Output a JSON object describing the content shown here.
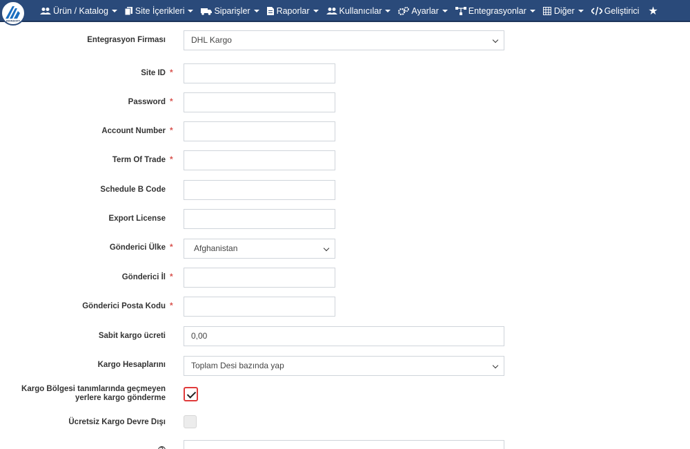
{
  "nav": {
    "items": [
      {
        "label": "Ürün / Katalog",
        "icon": "users-icon"
      },
      {
        "label": "Site İçerikleri",
        "icon": "copy-icon"
      },
      {
        "label": "Siparişler",
        "icon": "truck-icon"
      },
      {
        "label": "Raporlar",
        "icon": "file-icon"
      },
      {
        "label": "Kullanıcılar",
        "icon": "users-icon"
      },
      {
        "label": "Ayarlar",
        "icon": "gears-icon"
      },
      {
        "label": "Entegrasyonlar",
        "icon": "network-icon"
      },
      {
        "label": "Diğer",
        "icon": "grid-icon"
      },
      {
        "label": "Geliştirici",
        "icon": "code-icon"
      }
    ],
    "logo_text": "AKINSOFT"
  },
  "form": {
    "firm": {
      "label": "Entegrasyon Firması",
      "value": "DHL Kargo"
    },
    "site_id": {
      "label": "Site ID",
      "value": ""
    },
    "password": {
      "label": "Password",
      "value": ""
    },
    "account_number": {
      "label": "Account Number",
      "value": ""
    },
    "term_of_trade": {
      "label": "Term Of Trade",
      "value": ""
    },
    "schedule_b": {
      "label": "Schedule B Code",
      "value": ""
    },
    "export_license": {
      "label": "Export License",
      "value": ""
    },
    "sender_country": {
      "label": "Gönderici Ülke",
      "value": "Afghanistan"
    },
    "sender_city": {
      "label": "Gönderici İl",
      "value": ""
    },
    "sender_postcode": {
      "label": "Gönderici Posta Kodu",
      "value": ""
    },
    "fixed_fee": {
      "label": "Sabit kargo ücreti",
      "value": "0,00"
    },
    "calc": {
      "label": "Kargo Hesaplarını",
      "value": "Toplam Desi bazında yap"
    },
    "no_region": {
      "label_line1": "Kargo Bölgesi tanımlarında geçmeyen",
      "label_line2": "yerlere kargo gönderme",
      "checked": true
    },
    "free_disabled": {
      "label": "Ücretsiz Kargo Devre Dışı",
      "checked": false
    },
    "required_mark": "*",
    "info_symbol": "?"
  }
}
